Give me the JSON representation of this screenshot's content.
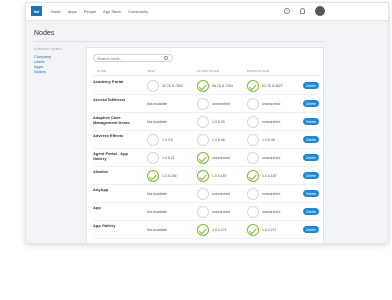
{
  "brand": "itsl",
  "nav": [
    "Node",
    "Apps",
    "People",
    "App Store",
    "Community"
  ],
  "title": "Nodes",
  "sidebar": {
    "heading": "COMPANY ADMIN",
    "links": [
      "Company",
      "Users",
      "Apps",
      "Nodes"
    ]
  },
  "search_placeholder": "Search node...",
  "columns": [
    "NODE",
    "TEST",
    "ACCEPTANCE",
    "PRODUCTION"
  ],
  "delete_label": "Delete",
  "rows": [
    {
      "name": "Academy Portal",
      "test": {
        "ok": false,
        "text": "32.7K 8.7062"
      },
      "acceptance": {
        "ok": true,
        "text": "56.7K 8.7434"
      },
      "production": {
        "ok": true,
        "text": "61.7K 8.4627"
      }
    },
    {
      "name": "AccessToMessrs",
      "test": {
        "na": true,
        "text": "Not available"
      },
      "acceptance": {
        "ok": false,
        "text": "unsearched"
      },
      "production": {
        "ok": false,
        "text": "unsearched"
      }
    },
    {
      "name": "Adaptive Case Management Demo",
      "test": {
        "na": true,
        "text": "Not available"
      },
      "acceptance": {
        "ok": false,
        "text": "1.0.6.20"
      },
      "production": {
        "ok": false,
        "text": "unsearched"
      }
    },
    {
      "name": "Adverse Effects",
      "test": {
        "ok": false,
        "text": "1.0.0.8"
      },
      "acceptance": {
        "ok": false,
        "text": "1.0.6.46"
      },
      "production": {
        "ok": false,
        "text": "1.0.6.46"
      }
    },
    {
      "name": "Agent Portal - App Gallery",
      "test": {
        "ok": false,
        "text": "1.0.6.21"
      },
      "acceptance": {
        "ok": true,
        "text": "unsearched"
      },
      "production": {
        "ok": false,
        "text": "unsearched"
      }
    },
    {
      "name": "Alkaline",
      "test": {
        "ok": true,
        "text": "1.0.0.206"
      },
      "acceptance": {
        "ok": true,
        "text": "1.0.0.187"
      },
      "production": {
        "ok": true,
        "text": "1.0.0.187"
      }
    },
    {
      "name": "AnyApp",
      "test": {
        "na": true,
        "text": "Not available"
      },
      "acceptance": {
        "ok": false,
        "text": "unsearched"
      },
      "production": {
        "ok": false,
        "text": "unsearched"
      }
    },
    {
      "name": "App",
      "test": {
        "na": true,
        "text": "Not available"
      },
      "acceptance": {
        "ok": false,
        "text": "unsearched"
      },
      "production": {
        "ok": false,
        "text": "unsearched"
      }
    },
    {
      "name": "App Gallery",
      "test": {
        "na": true,
        "text": "Not available"
      },
      "acceptance": {
        "ok": true,
        "text": "1.0.0.271"
      },
      "production": {
        "ok": true,
        "text": "1.0.0.271"
      }
    }
  ],
  "colors": {
    "accent": "#1e88d8",
    "success": "#7dbb2f",
    "brand": "#1e73b8"
  },
  "icons": [
    "help-icon",
    "bell-icon",
    "search-icon",
    "check-icon"
  ]
}
